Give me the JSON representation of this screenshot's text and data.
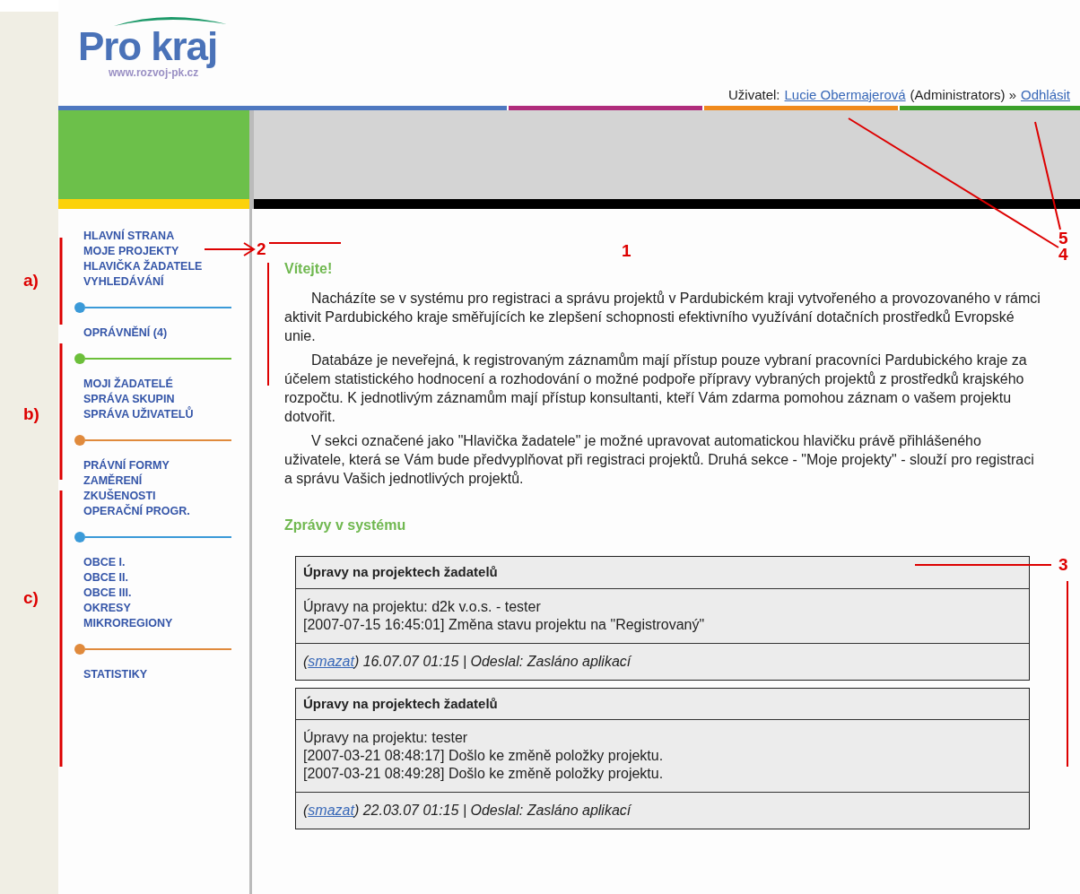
{
  "logo": {
    "name": "Pro kraj",
    "url": "www.rozvoj-pk.cz"
  },
  "user_bar": {
    "label": "Uživatel:",
    "user": "Lucie Obermajerová",
    "role": "(Administrators) »",
    "logout": "Odhlásit"
  },
  "sidebar": {
    "groups": [
      {
        "items": [
          "HLAVNÍ STRANA",
          "MOJE PROJEKTY",
          "HLAVIČKA ŽADATELE",
          "VYHLEDÁVÁNÍ"
        ],
        "color": "#3b9ad8"
      },
      {
        "items": [
          "OPRÁVNĚNÍ (4)"
        ],
        "color": "#6cbf3a"
      },
      {
        "items": [
          "MOJI ŽADATELÉ",
          "SPRÁVA SKUPIN",
          "SPRÁVA UŽIVATELŮ"
        ],
        "color": "#e08a3c"
      },
      {
        "items": [
          "PRÁVNÍ FORMY",
          "ZAMĚRENÍ",
          "ZKUŠENOSTI",
          "OPERAČNÍ PROGR."
        ],
        "color": "#3b9ad8"
      },
      {
        "items": [
          "OBCE I.",
          "OBCE II.",
          "OBCE III.",
          "OKRESY",
          "MIKROREGIONY"
        ],
        "color": "#e08a3c"
      },
      {
        "items": [
          "STATISTIKY"
        ]
      }
    ]
  },
  "welcome": {
    "title": "Vítejte!",
    "paragraphs": [
      "Nacházíte se v systému pro registraci a správu projektů v Pardubickém kraji vytvořeného a provozovaného v rámci aktivit Pardubického kraje směřujících ke zlepšení schopnosti efektivního využívání dotačních prostředků Evropské unie.",
      "Databáze je neveřejná, k registrovaným záznamům mají přístup pouze vybraní pracovníci Pardubického kraje za účelem statistického hodnocení a rozhodování o možné podpoře přípravy vybraných projektů z prostředků krajského rozpočtu. K jednotlivým záznamům mají přístup konsultanti, kteří Vám zdarma pomohou záznam o vašem projektu dotvořit.",
      "V sekci označené jako \"Hlavička žadatele\" je možné upravovat automatickou hlavičku právě přihlášeného uživatele, která se Vám bude předvyplňovat při registraci projektů. Druhá sekce - \"Moje projekty\" - slouží pro registraci a správu Vašich jednotlivých projektů."
    ]
  },
  "messages": {
    "title": "Zprávy v systému",
    "items": [
      {
        "title": "Úpravy na projektech žadatelů",
        "lines": [
          "Úpravy na projektu: d2k v.o.s. - tester",
          "[2007-07-15 16:45:01] Změna stavu projektu na \"Registrovaný\""
        ],
        "before": "(",
        "link": "smazat",
        "after": ") 16.07.07 01:15 | Odeslal: Zasláno aplikací"
      },
      {
        "title": "Úpravy na projektech žadatelů",
        "lines": [
          "Úpravy na projektu: tester",
          "[2007-03-21 08:48:17] Došlo ke změně položky projektu.",
          "[2007-03-21 08:49:28] Došlo ke změně položky projektu."
        ],
        "before": "(",
        "link": "smazat",
        "after": ") 22.03.07 01:15 | Odeslal: Zasláno aplikací"
      }
    ]
  },
  "annotations": [
    "5",
    "2",
    "1",
    "4",
    "a)",
    "b)",
    "3",
    "c)"
  ]
}
